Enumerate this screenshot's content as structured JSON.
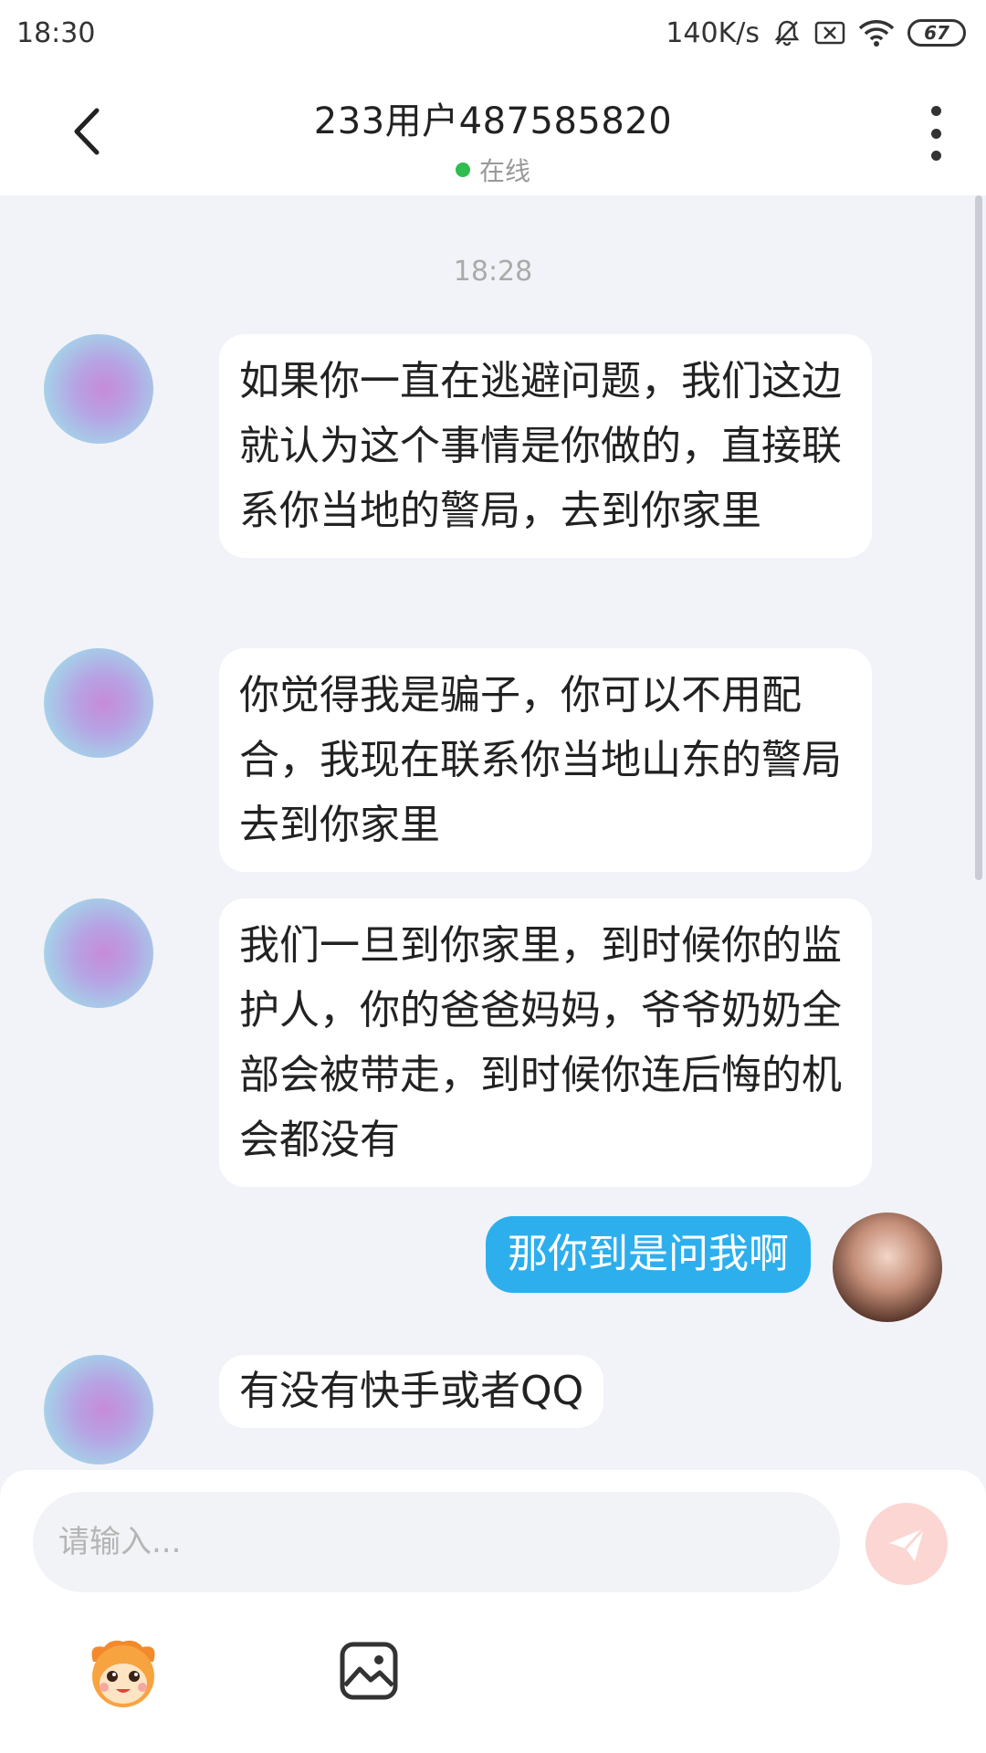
{
  "status_bar": {
    "time": "18:30",
    "network_speed": "140K/s",
    "battery_level": "67",
    "icons": [
      "mute-bell-icon",
      "sim-x-icon",
      "wifi-icon",
      "battery-icon"
    ]
  },
  "header": {
    "title": "233用户487585820",
    "status_text": "在线",
    "status_color": "#2ebd4e"
  },
  "chat": {
    "timestamp": "18:28",
    "messages": [
      {
        "sender": "other",
        "text": "如果你一直在逃避问题，我们这边就认为这个事情是你做的，直接联系你当地的警局，去到你家里"
      },
      {
        "sender": "other",
        "text": "你觉得我是骗子，你可以不用配合，我现在联系你当地山东的警局去到你家里"
      },
      {
        "sender": "other",
        "text": "我们一旦到你家里，到时候你的监护人，你的爸爸妈妈，爷爷奶奶全部会被带走，到时候你连后悔的机会都没有"
      },
      {
        "sender": "me",
        "text": "那你到是问我啊"
      },
      {
        "sender": "other",
        "text": "有没有快手或者QQ"
      }
    ]
  },
  "composer": {
    "placeholder": "请输入...",
    "accent_send": "#fbd6d2",
    "accent_bubble_me": "#2dafee"
  }
}
